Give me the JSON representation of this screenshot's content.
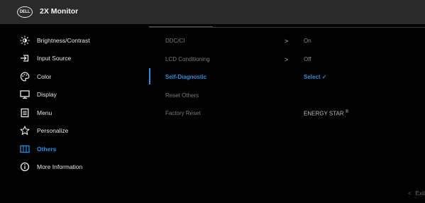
{
  "header": {
    "logo_text": "DELL",
    "title": "2X Monitor"
  },
  "menu": {
    "items": [
      {
        "label": "Brightness/Contrast",
        "icon": "brightness-icon"
      },
      {
        "label": "Input Source",
        "icon": "input-source-icon"
      },
      {
        "label": "Color",
        "icon": "color-palette-icon"
      },
      {
        "label": "Display",
        "icon": "display-icon"
      },
      {
        "label": "Menu",
        "icon": "menu-icon"
      },
      {
        "label": "Personalize",
        "icon": "star-icon"
      },
      {
        "label": "Others",
        "icon": "others-icon",
        "active": true
      },
      {
        "label": "More Information",
        "icon": "info-icon"
      }
    ]
  },
  "submenu": {
    "rows": [
      {
        "name": "DDC/CI",
        "arrow": ">",
        "value": "On"
      },
      {
        "name": "LCD Conditioning",
        "arrow": ">",
        "value": "Off"
      },
      {
        "name": "Self-Diagnostic",
        "value": "Select ✓",
        "active": true
      },
      {
        "name": "Reset Others"
      },
      {
        "name": "Factory Reset",
        "value": "ENERGY STAR",
        "value_sup": "®"
      }
    ]
  },
  "footer": {
    "exit_label": "Exit",
    "exit_chevron": "<"
  },
  "colors": {
    "accent": "#2a8fe0",
    "titlebar": "#2a2a2a",
    "background": "#000000"
  }
}
